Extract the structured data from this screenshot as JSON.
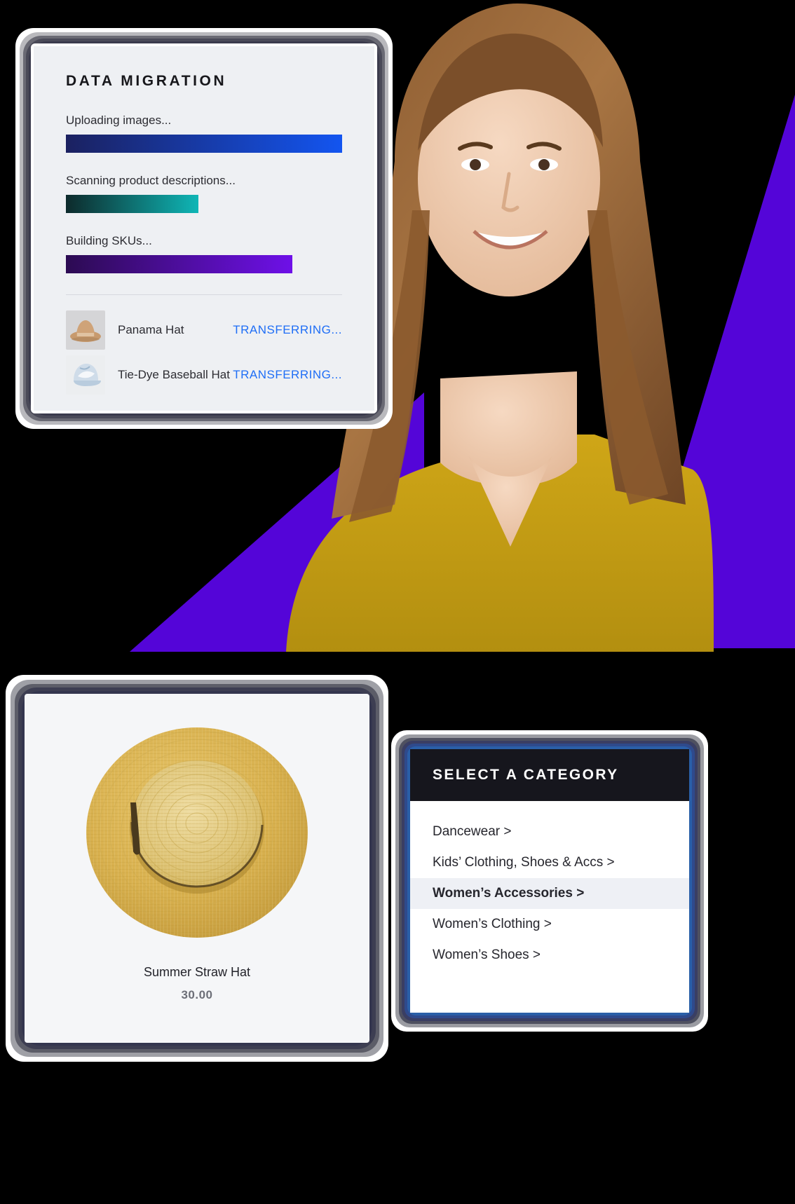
{
  "theme": {
    "background": "#000000",
    "accent_purple": "#5405D8",
    "link_blue": "#1F6EF6",
    "panel_grey": "#EEF0F3",
    "dark_header": "#16161D"
  },
  "migration_card": {
    "title": "DATA MIGRATION",
    "tasks": [
      {
        "label": "Uploading images...",
        "progress": 100,
        "gradient_from": "#1B2160",
        "gradient_to": "#1355F0"
      },
      {
        "label": "Scanning product descriptions...",
        "progress": 48,
        "gradient_from": "#0D2A2B",
        "gradient_to": "#0FB6B6"
      },
      {
        "label": "Building SKUs...",
        "progress": 82,
        "gradient_from": "#2C0B52",
        "gradient_to": "#6E10E8"
      }
    ],
    "items": [
      {
        "thumb": "panama-hat-thumb",
        "name": "Panama Hat",
        "status": "TRANSFERRING..."
      },
      {
        "thumb": "tie-dye-cap-thumb",
        "name": "Tie-Dye Baseball Hat",
        "status": "TRANSFERRING..."
      }
    ]
  },
  "product_card": {
    "image": "summer-straw-hat-photo",
    "name": "Summer Straw Hat",
    "price": "30.00"
  },
  "category_card": {
    "header": "SELECT A CATEGORY",
    "items": [
      {
        "label": "Dancewear >",
        "selected": false
      },
      {
        "label": "Kids’ Clothing, Shoes & Accs >",
        "selected": false
      },
      {
        "label": "Women’s Accessories >",
        "selected": true
      },
      {
        "label": "Women’s Clothing >",
        "selected": false
      },
      {
        "label": "Women’s Shoes >",
        "selected": false
      }
    ]
  },
  "hero": {
    "image": "smiling-woman-yellow-tshirt"
  }
}
